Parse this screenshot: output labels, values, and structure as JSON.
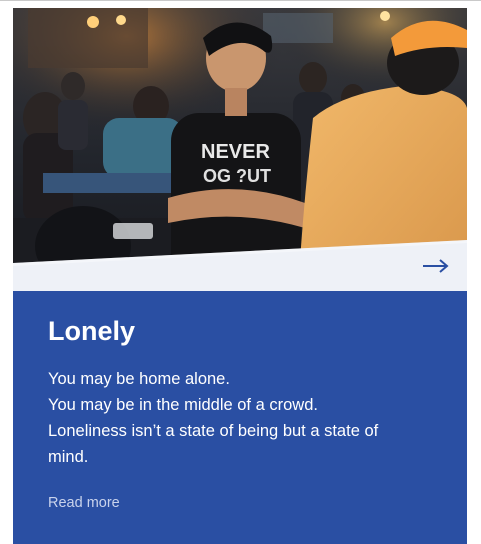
{
  "card": {
    "title": "Lonely",
    "body_lines": [
      "You may be home alone.",
      "You may be in the middle of a crowd.",
      "Loneliness isn’t a state of being but a state of",
      "mind."
    ],
    "read_more_label": "Read more",
    "shirt_text_line1": "NEVER",
    "shirt_text_line2": "OG ?UT"
  },
  "colors": {
    "card_background": "#2a4fa3",
    "text": "#ffffff",
    "read_more": "#c9d3ec",
    "arrow": "#2a4fa3",
    "wedge": "#eef1f7"
  },
  "icons": {
    "next": "arrow-right-icon"
  }
}
